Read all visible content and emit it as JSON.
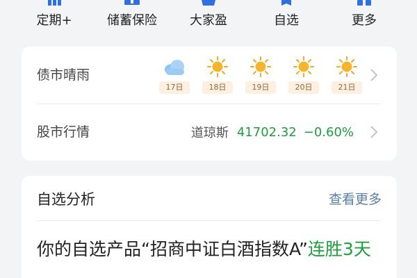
{
  "nav": {
    "items": [
      {
        "label": "定期+",
        "icon": "term-deposit-icon"
      },
      {
        "label": "储蓄保险",
        "icon": "savings-insurance-icon"
      },
      {
        "label": "大家盈",
        "icon": "daijiaying-icon"
      },
      {
        "label": "自选",
        "icon": "watchlist-icon"
      },
      {
        "label": "更多",
        "icon": "more-icon"
      }
    ],
    "icon_color": "#2f6fe0"
  },
  "bond": {
    "title": "债市晴雨",
    "days": [
      {
        "date": "17日",
        "weather": "cloudy-icon"
      },
      {
        "date": "18日",
        "weather": "sunny-icon"
      },
      {
        "date": "19日",
        "weather": "sunny-icon"
      },
      {
        "date": "20日",
        "weather": "sunny-icon"
      },
      {
        "date": "21日",
        "weather": "sunny-icon"
      }
    ]
  },
  "stock": {
    "title": "股市行情",
    "index_name": "道琼斯",
    "value": "41702.32",
    "change": "−0.60%",
    "color": "#1f9d3f"
  },
  "analysis": {
    "title": "自选分析",
    "more": "查看更多",
    "text_prefix": "你的自选产品“招商中证白酒指数A”",
    "text_highlight": "连胜3天"
  }
}
